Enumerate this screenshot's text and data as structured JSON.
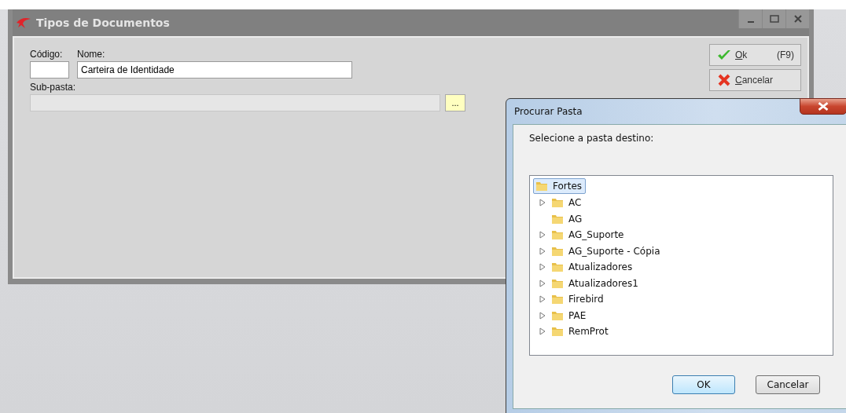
{
  "window": {
    "title": "Tipos de Documentos"
  },
  "form": {
    "codigo_label": "Código:",
    "nome_label": "Nome:",
    "nome_value": "Carteira de Identidade",
    "subpasta_label": "Sub-pasta:",
    "subpasta_disabled": true,
    "browse_label": "..."
  },
  "buttons": [
    {
      "label": "Ok",
      "shortcut": "(F9)",
      "kind": "ok"
    },
    {
      "label": "Cancelar",
      "kind": "cancel"
    }
  ],
  "dialog": {
    "title": "Procurar Pasta",
    "prompt": "Selecione a pasta destino:",
    "tree": [
      {
        "name": "Fortes",
        "selected": true,
        "children": [
          {
            "name": "AC",
            "selected": false,
            "expandable": true
          },
          {
            "name": "AG",
            "selected": false,
            "expandable": false
          },
          {
            "name": "AG_Suporte",
            "selected": false,
            "expandable": true
          },
          {
            "name": "AG_Suporte - Cópia",
            "selected": false,
            "expandable": true
          },
          {
            "name": "Atualizadores",
            "selected": false,
            "expandable": true
          },
          {
            "name": "Atualizadores1",
            "selected": false,
            "expandable": true
          },
          {
            "name": "Firebird",
            "selected": false,
            "expandable": true
          },
          {
            "name": "PAE",
            "selected": false,
            "expandable": true
          },
          {
            "name": "RemProt",
            "selected": false,
            "expandable": true
          }
        ]
      }
    ],
    "buttons": [
      {
        "label": "OK",
        "default": true
      },
      {
        "label": "Cancelar",
        "default": false
      }
    ]
  }
}
